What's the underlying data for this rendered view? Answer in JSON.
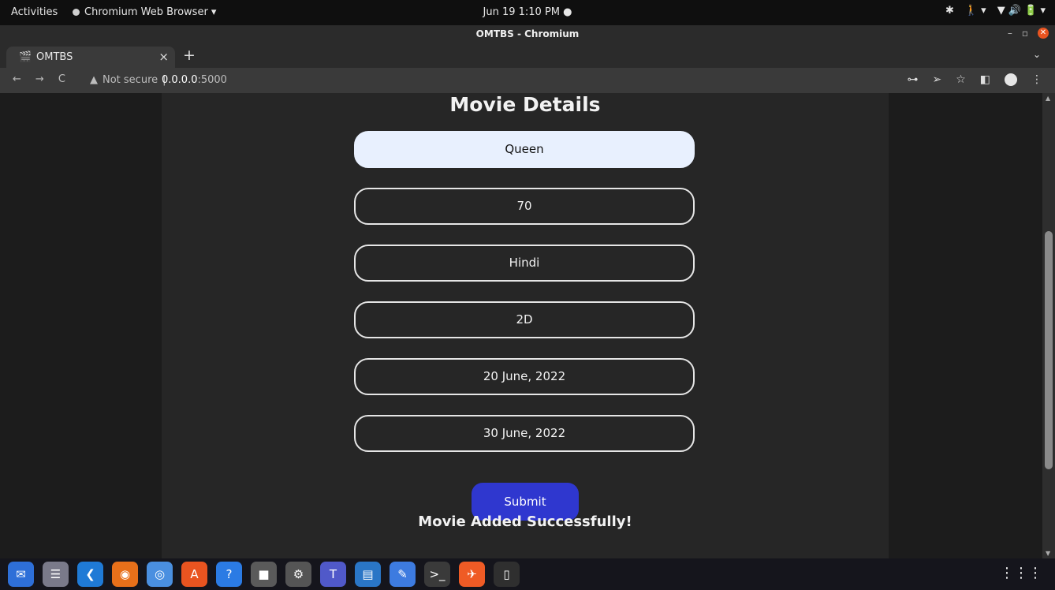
{
  "system_bar": {
    "activities": "Activities",
    "app_menu": "Chromium Web Browser ▾",
    "clock": "Jun 19  1:10 PM  ●",
    "tray": [
      "✱",
      "🚶 ▾",
      "▼ 🔊 🔋 ▾"
    ]
  },
  "window": {
    "title": "OMTBS - Chromium",
    "controls": {
      "minimize": "–",
      "maximize": "▫",
      "close": "✕"
    }
  },
  "tabs": [
    {
      "label": "OMTBS",
      "favicon": "🎬",
      "close": "×"
    }
  ],
  "new_tab": "+",
  "tab_menu": "⌄",
  "address_bar": {
    "back": "←",
    "forward": "→",
    "reload": "C",
    "security_icon": "▲",
    "security_label": "Not secure",
    "separator": "|",
    "url_host": "0.0.0.0",
    "url_port": ":5000",
    "right_icons": [
      "⊶",
      "➢",
      "☆",
      "◧",
      "⋮"
    ]
  },
  "page": {
    "heading": "Movie Details",
    "fields": [
      {
        "name": "movie-name-input",
        "value": "Queen",
        "autofilled": true
      },
      {
        "name": "price-input",
        "value": "70"
      },
      {
        "name": "language-input",
        "value": "Hindi"
      },
      {
        "name": "format-input",
        "value": "2D"
      },
      {
        "name": "start-date-input",
        "value": "20 June, 2022"
      },
      {
        "name": "end-date-input",
        "value": "30 June, 2022"
      }
    ],
    "submit_label": "Submit",
    "status_message": "Movie Added Successfully!"
  },
  "scrollbar": {
    "up": "▲",
    "down": "▼"
  },
  "dock": {
    "apps": [
      {
        "name": "thunderbird-icon",
        "glyph": "✉",
        "color": "#2e6fd8"
      },
      {
        "name": "text-reader-icon",
        "glyph": "☰",
        "color": "#7a7a8a"
      },
      {
        "name": "vscode-icon",
        "glyph": "❮",
        "color": "#1f7ad6"
      },
      {
        "name": "firefox-icon",
        "glyph": "◉",
        "color": "#e8701a"
      },
      {
        "name": "chromium-icon",
        "glyph": "◎",
        "color": "#4a8fe0"
      },
      {
        "name": "app-store-icon",
        "glyph": "A",
        "color": "#e95420"
      },
      {
        "name": "help-icon",
        "glyph": "?",
        "color": "#2b7be4"
      },
      {
        "name": "files-icon",
        "glyph": "■",
        "color": "#5a5a5a"
      },
      {
        "name": "settings-icon",
        "glyph": "⚙",
        "color": "#555"
      },
      {
        "name": "teams-icon",
        "glyph": "T",
        "color": "#5059c9"
      },
      {
        "name": "libreoffice-writer-icon",
        "glyph": "▤",
        "color": "#2a76c6"
      },
      {
        "name": "text-editor-icon",
        "glyph": "✎",
        "color": "#3d7be0"
      },
      {
        "name": "terminal-icon",
        "glyph": ">_",
        "color": "#3a3a3a"
      },
      {
        "name": "postman-icon",
        "glyph": "✈",
        "color": "#ef5b25"
      },
      {
        "name": "usb-icon",
        "glyph": "▯",
        "color": "#2f2f2f"
      }
    ],
    "show_apps": "⋮⋮⋮"
  }
}
